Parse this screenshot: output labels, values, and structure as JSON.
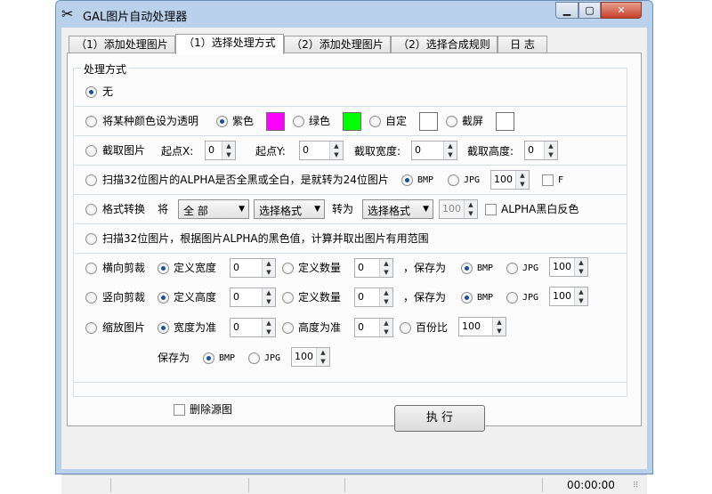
{
  "window": {
    "title": "GAL图片自动处理器",
    "app_icon": "✂"
  },
  "tabs": [
    {
      "label": "（1）添加处理图片"
    },
    {
      "label": "（1）选择处理方式"
    },
    {
      "label": "（2）添加处理图片"
    },
    {
      "label": "（2）选择合成规则"
    },
    {
      "label": "日  志"
    }
  ],
  "group": {
    "legend": "处理方式"
  },
  "rows": {
    "none": {
      "label": "无"
    },
    "transparent": {
      "label": "将某种颜色设为透明",
      "purple": "紫色",
      "green": "绿色",
      "custom": "自定",
      "screenshot": "截屏",
      "colors": {
        "purple": "#ff00ff",
        "green": "#00ff00",
        "custom": "#ffffff",
        "screenshot": "#ffffff"
      }
    },
    "crop": {
      "label": "截取图片",
      "x_label": "起点X:",
      "x": "0",
      "y_label": "起点Y:",
      "y": "0",
      "w_label": "截取宽度:",
      "w": "0",
      "h_label": "截取高度:",
      "h": "0"
    },
    "scan_alpha": {
      "label": "扫描32位图片的ALPHA是否全黑或全白，是就转为24位图片",
      "bmp": "BMP",
      "jpg": "JPG",
      "quality": "100",
      "f": "F"
    },
    "convert": {
      "label": "格式转换",
      "jiang": "将",
      "scope": "全 部",
      "from": "选择格式",
      "to_label": "转为",
      "to": "选择格式",
      "quality": "100",
      "alpha_invert": "ALPHA黑白反色"
    },
    "scan_range": {
      "label": "扫描32位图片，根据图片ALPHA的黑色值，计算并取出图片有用范围"
    },
    "hcut": {
      "label": "横向剪裁",
      "opt1": "定义宽度",
      "v1": "0",
      "opt2": "定义数量",
      "v2": "0",
      "save": "，保存为",
      "bmp": "BMP",
      "jpg": "JPG",
      "quality": "100"
    },
    "vcut": {
      "label": "竖向剪裁",
      "opt1": "定义高度",
      "v1": "0",
      "opt2": "定义数量",
      "v2": "0",
      "save": "，保存为",
      "bmp": "BMP",
      "jpg": "JPG",
      "quality": "100"
    },
    "scale": {
      "label": "缩放图片",
      "opt1": "宽度为准",
      "v1": "0",
      "opt2": "高度为准",
      "v2": "0",
      "opt3": "百份比",
      "v3": "100",
      "save": "保存为",
      "bmp": "BMP",
      "jpg": "JPG",
      "quality": "100"
    }
  },
  "footer": {
    "delete_source": "删除源图",
    "execute": "执 行"
  },
  "statusbar": {
    "time": "00:00:00"
  }
}
